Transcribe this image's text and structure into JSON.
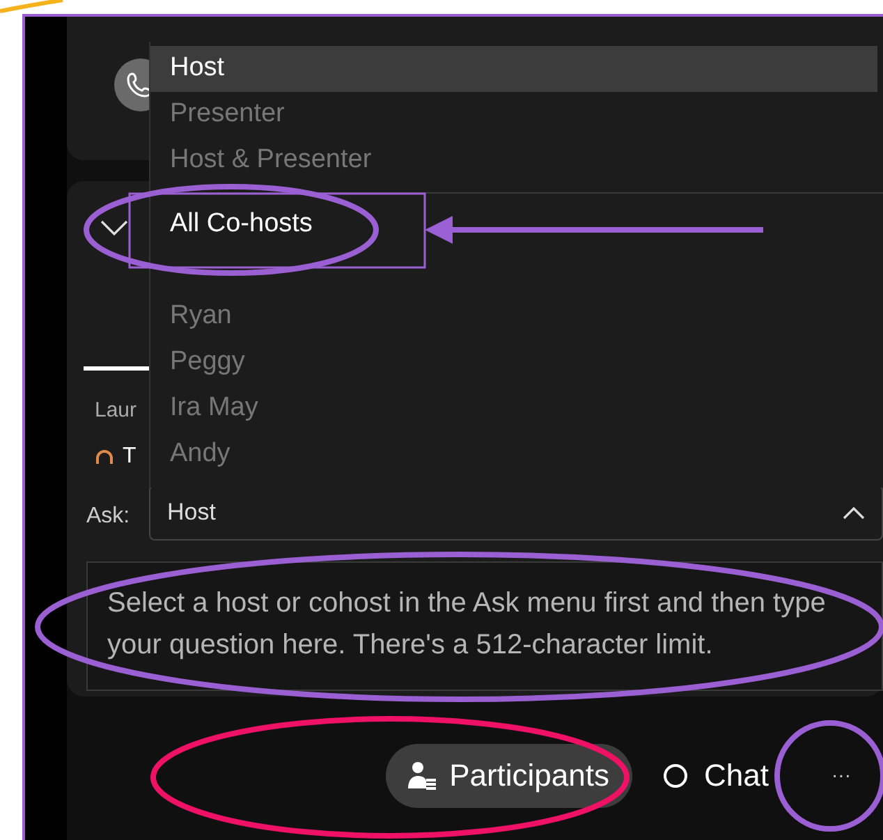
{
  "ask_menu": {
    "groups": [
      {
        "items": [
          {
            "label": "Host",
            "selected": true
          },
          {
            "label": "Presenter",
            "selected": false
          },
          {
            "label": "Host & Presenter",
            "selected": false
          }
        ]
      },
      {
        "items": [
          {
            "label": "All Co-hosts",
            "selected": false,
            "highlighted": true
          },
          {
            "label": "Ryan",
            "selected": false,
            "highlighted": false
          },
          {
            "label": "Peggy",
            "selected": false,
            "highlighted": false
          },
          {
            "label": "Ira May",
            "selected": false,
            "highlighted": false
          },
          {
            "label": "Andy",
            "selected": false,
            "highlighted": false
          }
        ]
      }
    ]
  },
  "qa_panel": {
    "author": "Laur",
    "status_text": "T",
    "ask_label": "Ask:",
    "ask_value": "Host",
    "question_placeholder": "Select a host or cohost in the Ask menu first and then type your question here. There's a 512-character limit."
  },
  "bottom_bar": {
    "buttons": [
      {
        "label": "Participants",
        "selected": true,
        "kind": "participants"
      },
      {
        "label": "Chat",
        "selected": false,
        "kind": "chat"
      },
      {
        "label": "···",
        "selected": false,
        "kind": "more"
      }
    ]
  }
}
